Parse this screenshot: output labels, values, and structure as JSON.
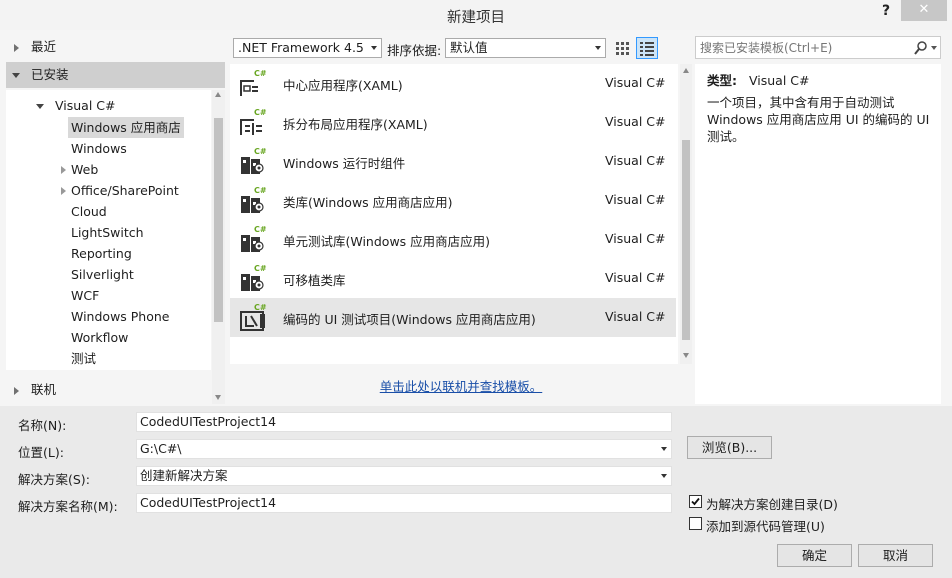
{
  "window": {
    "title": "新建项目",
    "help_label": "?",
    "close_label": "✕"
  },
  "tree": {
    "recent": "最近",
    "installed": "已安装",
    "visual_csharp": "Visual C#",
    "items": [
      {
        "label": "Windows 应用商店",
        "selected": true
      },
      {
        "label": "Windows"
      },
      {
        "label": "Web",
        "expandable": true
      },
      {
        "label": "Office/SharePoint",
        "expandable": true
      },
      {
        "label": "Cloud"
      },
      {
        "label": "LightSwitch"
      },
      {
        "label": "Reporting"
      },
      {
        "label": "Silverlight"
      },
      {
        "label": "WCF"
      },
      {
        "label": "Windows Phone"
      },
      {
        "label": "Workflow"
      },
      {
        "label": "测试"
      }
    ],
    "online": "联机"
  },
  "toolbar": {
    "framework": ".NET Framework 4.5",
    "sort_label": "排序依据:",
    "sort_value": "默认值"
  },
  "templates": [
    {
      "name": "中心应用程序(XAML)",
      "lang": "Visual C#",
      "icon": "hub-app-icon"
    },
    {
      "name": "拆分布局应用程序(XAML)",
      "lang": "Visual C#",
      "icon": "split-app-icon"
    },
    {
      "name": "Windows 运行时组件",
      "lang": "Visual C#",
      "icon": "runtime-component-icon"
    },
    {
      "name": "类库(Windows 应用商店应用)",
      "lang": "Visual C#",
      "icon": "class-library-icon"
    },
    {
      "name": "单元测试库(Windows 应用商店应用)",
      "lang": "Visual C#",
      "icon": "unit-test-library-icon"
    },
    {
      "name": "可移植类库",
      "lang": "Visual C#",
      "icon": "portable-library-icon"
    },
    {
      "name": "编码的 UI 测试项目(Windows 应用商店应用)",
      "lang": "Visual C#",
      "icon": "coded-ui-test-icon",
      "selected": true
    }
  ],
  "online_link": "单击此处以联机并查找模板。",
  "search": {
    "placeholder": "搜索已安装模板(Ctrl+E)"
  },
  "details": {
    "type_label": "类型:",
    "type_value": "Visual C#",
    "description": "一个项目，其中含有用于自动测试 Windows 应用商店应用 UI 的编码的 UI 测试。"
  },
  "form": {
    "name_label": "名称(N):",
    "name_value": "CodedUITestProject14",
    "location_label": "位置(L):",
    "location_value": "G:\\C#\\",
    "browse_label": "浏览(B)...",
    "solution_label": "解决方案(S):",
    "solution_value": "创建新解决方案",
    "solution_name_label": "解决方案名称(M):",
    "solution_name_value": "CodedUITestProject14",
    "create_dir_label": "为解决方案创建目录(D)",
    "create_dir_checked": true,
    "add_source_label": "添加到源代码管理(U)",
    "add_source_checked": false,
    "ok_label": "确定",
    "cancel_label": "取消"
  },
  "colors": {
    "accent_cs": "#68a621",
    "selection": "#d9d9d9",
    "link": "#1a4fa8"
  }
}
